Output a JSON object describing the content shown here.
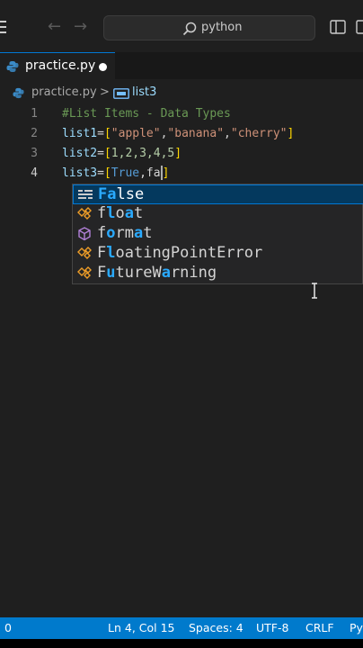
{
  "titlebar": {
    "search_text": "python"
  },
  "tab": {
    "filename": "practice.py"
  },
  "breadcrumb": {
    "file": "practice.py",
    "separator": ">",
    "symbol": "list3"
  },
  "editor": {
    "line_numbers": [
      "1",
      "2",
      "3",
      "4"
    ],
    "lines": [
      {
        "comment": "#List Items - Data Types"
      },
      {
        "var": "list1",
        "eq": "=",
        "open": "[",
        "s1": "\"apple\"",
        "c1": ",",
        "s2": "\"banana\"",
        "c2": ",",
        "s3": "\"cherry\"",
        "close": "]"
      },
      {
        "var": "list2",
        "eq": "=",
        "open": "[",
        "nums": "1,2,3,4,5",
        "close": "]"
      },
      {
        "var": "list3",
        "eq": "=",
        "open": "[",
        "kw": "True",
        "rest": ",fa",
        "close": "]"
      }
    ]
  },
  "suggestions": [
    {
      "match": "Fa",
      "rest": "lse",
      "icon": "keyword-icon"
    },
    {
      "pre": "f",
      "match": "l",
      "mid": "o",
      "match2": "a",
      "rest": "t",
      "icon": "class-icon"
    },
    {
      "pre": "f",
      "match": "o",
      "rest": "rm",
      "match2": "a",
      "rest2": "t",
      "icon": "method-cube-icon"
    },
    {
      "pre": "F",
      "match": "l",
      "rest": "oatingPointError",
      "icon": "class-icon"
    },
    {
      "pre": "F",
      "match": "u",
      "rest": "tureW",
      "match2": "a",
      "rest2": "rning",
      "icon": "class-icon"
    }
  ],
  "statusbar": {
    "left": "0",
    "position": "Ln 4, Col 15",
    "spaces": "Spaces: 4",
    "encoding": "UTF-8",
    "eol": "CRLF",
    "lang": "Py"
  },
  "colors": {
    "accent": "#0078d4",
    "status": "#007acc",
    "bg": "#1f1f1f"
  }
}
